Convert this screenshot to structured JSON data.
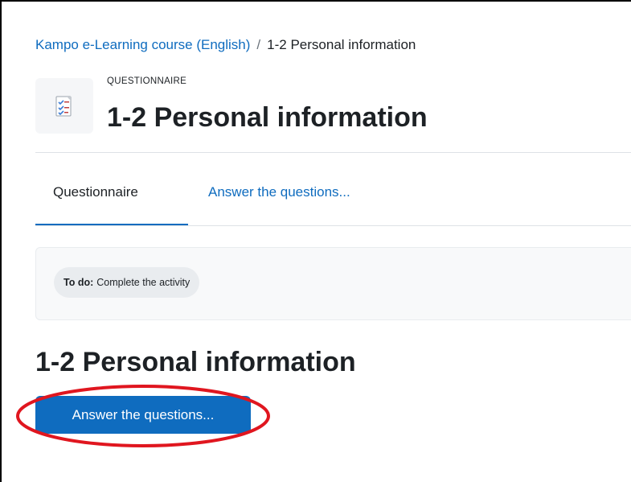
{
  "breadcrumb": {
    "course": "Kampo e-Learning course (English)",
    "separator": "/",
    "current": "1-2 Personal information"
  },
  "header": {
    "icon": "questionnaire-icon",
    "module_type": "QUESTIONNAIRE",
    "title": "1-2 Personal information"
  },
  "tabs": [
    {
      "label": "Questionnaire",
      "active": true
    },
    {
      "label": "Answer the questions...",
      "active": false
    }
  ],
  "activity": {
    "label": "To do:",
    "text": "Complete the activity"
  },
  "content": {
    "title": "1-2 Personal information",
    "button_label": "Answer the questions..."
  },
  "colors": {
    "link": "#0f6cbf",
    "primary_button": "#0f6cbf",
    "highlight": "#e0161f"
  }
}
